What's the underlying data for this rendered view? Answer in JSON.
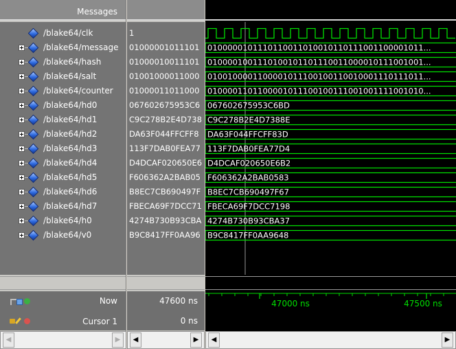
{
  "header": {
    "messages_label": "Messages"
  },
  "signals": [
    {
      "name": "/blake64/clk",
      "value": "1",
      "wave_text": "",
      "expandable": false
    },
    {
      "name": "/blake64/message",
      "value": "01000001011101",
      "wave_text": "0100000101110110011010010110111001100001011...",
      "expandable": true
    },
    {
      "name": "/blake64/hash",
      "value": "01000010011101",
      "wave_text": "0100001001110100101101110011000010111001001...",
      "expandable": true
    },
    {
      "name": "/blake64/salt",
      "value": "01001000011000",
      "wave_text": "0100100001100001011100100110010001110111011...",
      "expandable": true
    },
    {
      "name": "/blake64/counter",
      "value": "01000011011000",
      "wave_text": "0100001101100001011100100111001001111001010...",
      "expandable": true
    },
    {
      "name": "/blake64/hd0",
      "value": "067602675953C6",
      "wave_text": "067602675953C6BD",
      "expandable": true
    },
    {
      "name": "/blake64/hd1",
      "value": "C9C278B2E4D738",
      "wave_text": "C9C278B2E4D7388E",
      "expandable": true
    },
    {
      "name": "/blake64/hd2",
      "value": "DA63F044FFCFF8",
      "wave_text": "DA63F044FFCFF83D",
      "expandable": true
    },
    {
      "name": "/blake64/hd3",
      "value": "113F7DAB0FEA77",
      "wave_text": "113F7DAB0FEA77D4",
      "expandable": true
    },
    {
      "name": "/blake64/hd4",
      "value": "D4DCAF020650E6",
      "wave_text": "D4DCAF020650E6B2",
      "expandable": true
    },
    {
      "name": "/blake64/hd5",
      "value": "F606362A2BAB05",
      "wave_text": "F606362A2BAB0583",
      "expandable": true
    },
    {
      "name": "/blake64/hd6",
      "value": "B8EC7CB690497F",
      "wave_text": "B8EC7CB690497F67",
      "expandable": true
    },
    {
      "name": "/blake64/hd7",
      "value": "FBECA69F7DCC71",
      "wave_text": "FBECA69F7DCC7198",
      "expandable": true
    },
    {
      "name": "/blake64/h0",
      "value": "4274B730B93CBA",
      "wave_text": "4274B730B93CBA37",
      "expandable": true
    },
    {
      "name": "/blake64/v0",
      "value": "B9C8417FF0AA96",
      "wave_text": "B9C8417FF0AA9648",
      "expandable": true
    }
  ],
  "now": {
    "label": "Now",
    "value": "47600 ns"
  },
  "cursor": {
    "label": "Cursor 1",
    "value": "0 ns"
  },
  "timeline": {
    "labels": [
      "47000 ns",
      "47500 ns"
    ]
  },
  "colors": {
    "wave": "#00e000",
    "background": "#000000",
    "signal_icon": "#2f6be0",
    "panel": "#747474"
  }
}
